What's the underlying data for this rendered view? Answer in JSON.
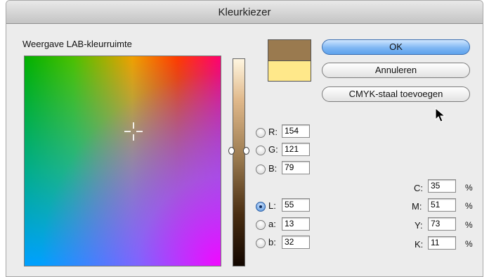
{
  "window": {
    "title": "Kleurkiezer"
  },
  "color_field": {
    "title": "Weergave LAB-kleurruimte"
  },
  "swatches": {
    "new_color": "#9a7a4f",
    "current_color": "#ffe88a"
  },
  "buttons": {
    "ok": "OK",
    "cancel": "Annuleren",
    "add_swatch": "CMYK-staal toevoegen"
  },
  "rgb": {
    "r": {
      "label": "R:",
      "value": "154"
    },
    "g": {
      "label": "G:",
      "value": "121"
    },
    "b": {
      "label": "B:",
      "value": "79"
    }
  },
  "lab": {
    "l": {
      "label": "L:",
      "value": "55",
      "selected": true
    },
    "a": {
      "label": "a:",
      "value": "13"
    },
    "b": {
      "label": "b:",
      "value": "32"
    }
  },
  "cmyk": {
    "c": {
      "label": "C:",
      "value": "35",
      "unit": "%"
    },
    "m": {
      "label": "M:",
      "value": "51",
      "unit": "%"
    },
    "y": {
      "label": "Y:",
      "value": "73",
      "unit": "%"
    },
    "k": {
      "label": "K:",
      "value": "11",
      "unit": "%"
    }
  }
}
